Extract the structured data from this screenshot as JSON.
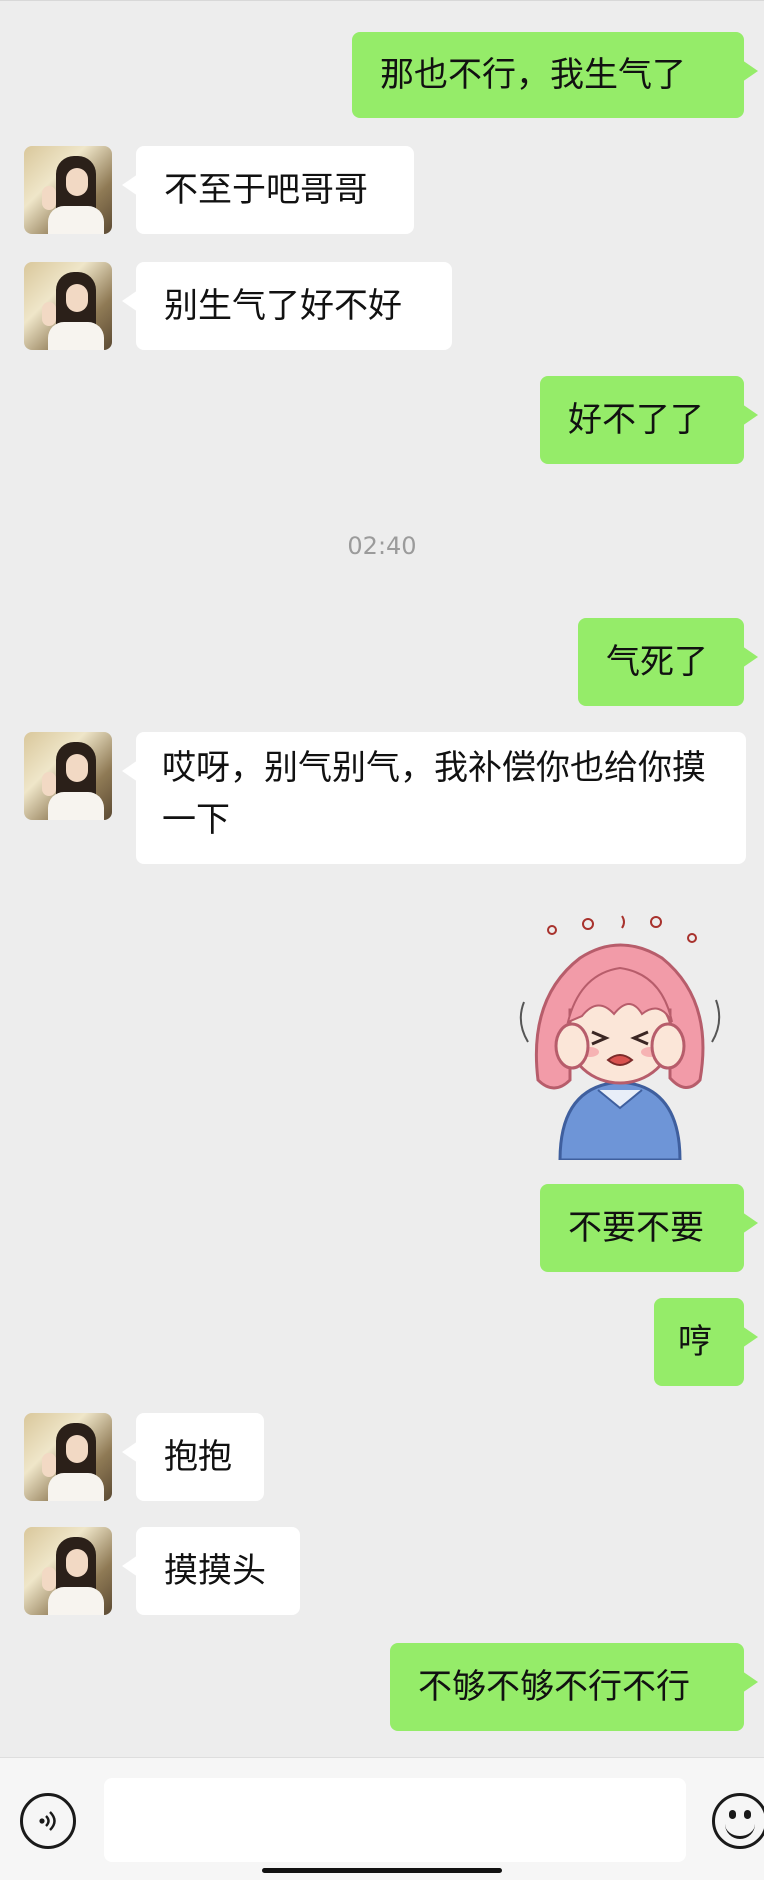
{
  "messages": [
    {
      "side": "right",
      "text": "那也不行，我生气了"
    },
    {
      "side": "left",
      "text": "不至于吧哥哥"
    },
    {
      "side": "left",
      "text": "别生气了好不好"
    },
    {
      "side": "right",
      "text": "好不了了"
    },
    {
      "type": "time",
      "text": "02:40"
    },
    {
      "side": "right",
      "text": "气死了"
    },
    {
      "side": "left",
      "text": "哎呀，别气别气，我补偿你也给你摸一下"
    },
    {
      "side": "right",
      "type": "sticker",
      "icon": "angry-girl-covering-ears-sticker"
    },
    {
      "side": "right",
      "text": "不要不要"
    },
    {
      "side": "right",
      "text": "哼"
    },
    {
      "side": "left",
      "text": "抱抱"
    },
    {
      "side": "left",
      "text": "摸摸头"
    },
    {
      "side": "right",
      "text": "不够不够不行不行"
    }
  ],
  "icons": {
    "voice": "voice-input-icon",
    "emoji": "emoji-icon"
  },
  "colors": {
    "background": "#ededed",
    "right_bubble": "#95ec69",
    "left_bubble": "#ffffff"
  }
}
